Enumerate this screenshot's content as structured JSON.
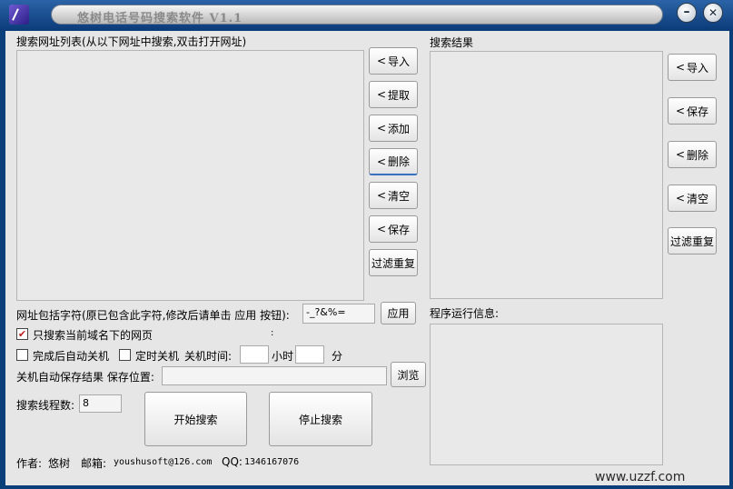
{
  "window": {
    "title": "悠树电话号码搜索软件 V1.1",
    "minimize": "–",
    "close": "✕"
  },
  "url_list": {
    "label": "搜索网址列表(从以下网址中搜索,双击打开网址)",
    "buttons": [
      "导入",
      "提取",
      "添加",
      "删除",
      "清空",
      "保存"
    ],
    "filter_button": "过滤重复"
  },
  "results": {
    "label": "搜索结果",
    "buttons": [
      "导入",
      "保存",
      "删除",
      "清空"
    ],
    "filter_button": "过滤重复"
  },
  "url_filter": {
    "label": "网址包括字符(原已包含此字符,修改后请单击 应用 按钮):",
    "value": "-_?&%=",
    "apply_button": "应用",
    "colon": ":"
  },
  "options": {
    "current_domain_only": {
      "label": "只搜索当前域名下的网页",
      "checked": true
    },
    "shutdown_after": {
      "label": "完成后自动关机",
      "checked": false
    },
    "timed_shutdown": {
      "label": "定时关机",
      "checked": false
    },
    "shutdown_time_label": "关机时间:",
    "hour_label": "小时",
    "minute_label": "分"
  },
  "autosave": {
    "label": "关机自动保存结果 保存位置:",
    "value": "",
    "browse_button": "浏览"
  },
  "threads": {
    "label": "搜索线程数:",
    "value": "8"
  },
  "actions": {
    "start": "开始搜索",
    "stop": "停止搜索"
  },
  "log": {
    "label": "程序运行信息:"
  },
  "footer": {
    "author_label": "作者:",
    "author": "悠树",
    "email_label": "邮箱:",
    "email": "youshusoft@126.com",
    "qq_label": "QQ:",
    "qq": "1346167076"
  },
  "watermark": "www.uzzf.com"
}
